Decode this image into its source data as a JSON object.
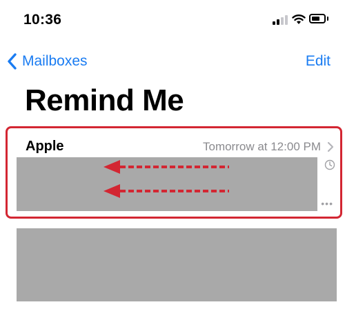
{
  "status_bar": {
    "time": "10:36",
    "icons": [
      "cellular-signal-icon",
      "wifi-icon",
      "battery-icon"
    ]
  },
  "nav": {
    "back_label": "Mailboxes",
    "edit_label": "Edit",
    "accent_color": "#1a7cf2"
  },
  "page": {
    "title": "Remind Me"
  },
  "messages": [
    {
      "sender": "Apple",
      "date": "Tomorrow at 12:00 PM",
      "icons": [
        "chevron-right-icon",
        "clock-icon",
        "more-icon"
      ],
      "highlight_color": "#d32632",
      "annotation": "swipe-left-arrows-icon"
    }
  ],
  "colors": {
    "redacted_gray": "#a9a9a9",
    "secondary_text": "#8a8a8e"
  }
}
